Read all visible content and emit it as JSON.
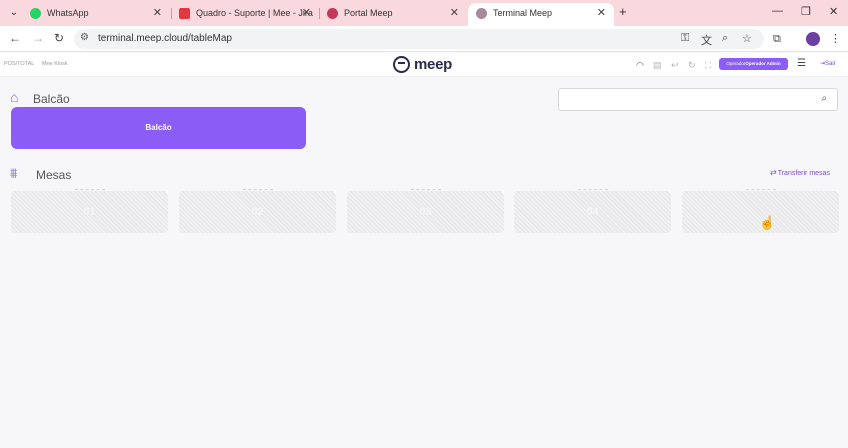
{
  "browser": {
    "tabs": [
      {
        "title": "WhatsApp",
        "favicon": "whatsapp-icon",
        "color": "#25d366"
      },
      {
        "title": "Quadro - Suporte | Mee - Jira",
        "favicon": "jira-icon",
        "color": "#e0383e"
      },
      {
        "title": "Portal Meep",
        "favicon": "meep-icon",
        "color": "#c4385a"
      },
      {
        "title": "Terminal Meep",
        "favicon": "terminal-icon",
        "color": "#a88a9c"
      }
    ],
    "url": "terminal.meep.cloud/tableMap"
  },
  "header": {
    "left_text_1": "POS/TOTAL",
    "left_text_2": "Mee Kiosk",
    "logo_text": "meep",
    "operator_prefix": "Operador",
    "operator_name": "Operador Admin",
    "exit_label": "Sair",
    "accent": "#8b5cf6"
  },
  "balcao": {
    "section_title": "Balcão",
    "button_label": "Balcão",
    "search_placeholder": ""
  },
  "mesas": {
    "section_title": "Mesas",
    "transfer_label": "Transferir mesas",
    "tables": [
      {
        "label": "01"
      },
      {
        "label": "02"
      },
      {
        "label": "03"
      },
      {
        "label": "04"
      },
      {
        "label": ""
      }
    ]
  }
}
